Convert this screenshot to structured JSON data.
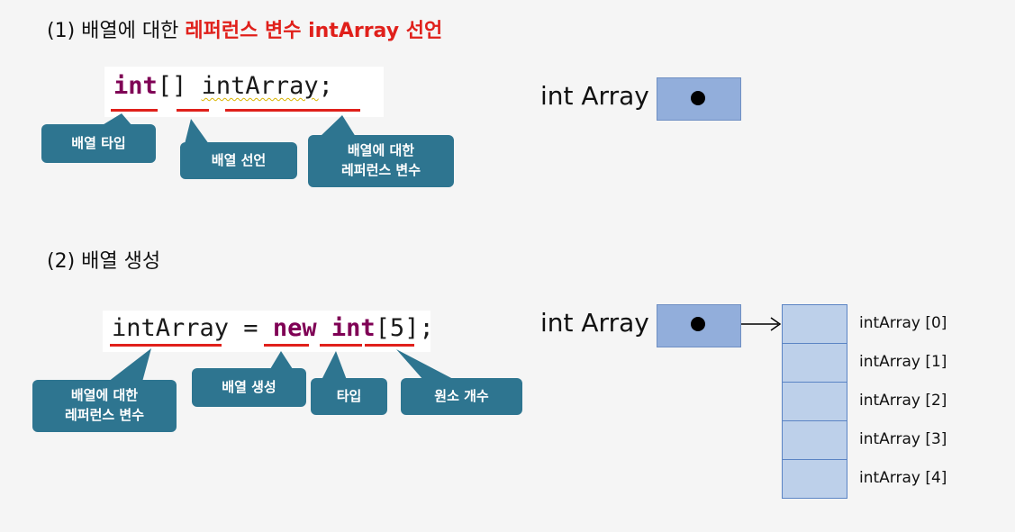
{
  "section1": {
    "heading_prefix": "(1) 배열에 대한 ",
    "heading_highlight": "레퍼런스 변수 intArray 선언",
    "code": {
      "type": "int",
      "brackets": "[]",
      "space": " ",
      "name": "intArray",
      "semicolon": ";"
    },
    "callouts": [
      "배열 타입",
      "배열 선언",
      "배열에 대한\n레퍼런스 변수"
    ],
    "var_label": "int Array"
  },
  "section2": {
    "heading": "(2) 배열 생성",
    "code": {
      "name": "intArray",
      "assign": " = ",
      "new_kw": "new",
      "space": " ",
      "type": "int",
      "open": "[",
      "size": "5",
      "close": "];"
    },
    "callouts": [
      "배열에 대한\n레퍼런스 변수",
      "배열 생성",
      "타입",
      "원소 개수"
    ],
    "var_label": "int Array",
    "elements": [
      "intArray [0]",
      "intArray [1]",
      "intArray [2]",
      "intArray [3]",
      "intArray [4]"
    ]
  },
  "colors": {
    "highlight": "#e0201b",
    "keyword": "#7f0055",
    "callout": "#2e7590",
    "ref_box": "#92aedb",
    "array_cell": "#bdd0ea"
  }
}
